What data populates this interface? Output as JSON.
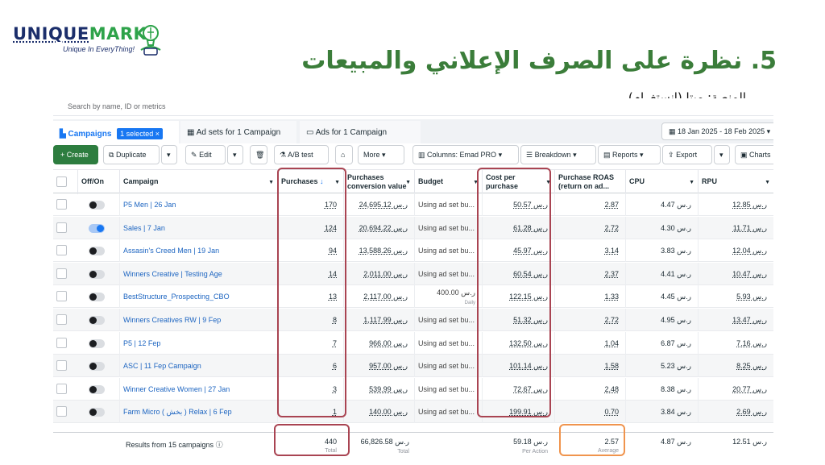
{
  "brand": {
    "name_a": "UNIQUE",
    "name_b": "MARK",
    "tagline": "Unique In EveryThing!"
  },
  "slide": {
    "title": "5. نظرة على الصرف الإعلاني والمبيعات",
    "subtitle": "المنصة: ميتا (انستغرام)"
  },
  "colors": {
    "title": "#3b7d3a",
    "accent": "#1877f2",
    "create": "#2d7d3f",
    "highlight_orange": "#f0944d",
    "highlight_red": "#a94452"
  },
  "search": {
    "placeholder": "Search by name, ID or metrics"
  },
  "tabs": {
    "campaigns": "Campaigns",
    "selected": "1 selected",
    "adsets": "Ad sets for 1 Campaign",
    "ads": "Ads for 1 Campaign",
    "date_range": "18 Jan 2025 - 18 Feb 2025"
  },
  "toolbar": {
    "create": "Create",
    "duplicate": "Duplicate",
    "edit": "Edit",
    "ab_test": "A/B test",
    "more": "More",
    "columns": "Columns: Emad PRO",
    "breakdown": "Breakdown",
    "reports": "Reports",
    "export": "Export",
    "charts": "Charts"
  },
  "columns": {
    "off_on": "Off/On",
    "campaign": "Campaign",
    "purchases": "Purchases",
    "conv_value_1": "Purchases",
    "conv_value_2": "conversion value",
    "budget": "Budget",
    "cpp_1": "Cost per",
    "cpp_2": "purchase",
    "roas_1": "Purchase ROAS",
    "roas_2": "(return on ad...",
    "cpu": "CPU",
    "rpu": "RPU"
  },
  "rows": [
    {
      "name": "P5 Men | 26 Jan",
      "purchases": "170",
      "value": "24,695.12 ر.س",
      "budget": "Using ad set bu...",
      "cpp": "50.57 ر.س",
      "roas": "2.87",
      "cpu": "4.47 ر.س",
      "rpu": "12.85 ر.س",
      "on": false
    },
    {
      "name": "Sales | 7 Jan",
      "purchases": "124",
      "value": "20,694.22 ر.س",
      "budget": "Using ad set bu...",
      "cpp": "61.28 ر.س",
      "roas": "2.72",
      "cpu": "4.30 ر.س",
      "rpu": "11.71 ر.س",
      "on": true
    },
    {
      "name": "Assasin's Creed Men | 19 Jan",
      "purchases": "94",
      "value": "13,588.26 ر.س",
      "budget": "Using ad set bu...",
      "cpp": "45.97 ر.س",
      "roas": "3.14",
      "cpu": "3.83 ر.س",
      "rpu": "12.04 ر.س",
      "on": false
    },
    {
      "name": "Winners Creative | Testing Age",
      "purchases": "14",
      "value": "2,011.00 ر.س",
      "budget": "Using ad set bu...",
      "cpp": "60.54 ر.س",
      "roas": "2.37",
      "cpu": "4.41 ر.س",
      "rpu": "10.47 ر.س",
      "on": false
    },
    {
      "name": "BestStructure_Prospecting_CBO",
      "purchases": "13",
      "value": "2,117.00 ر.س",
      "budget": "400.00 ر.س",
      "budget_sub": "Daily",
      "cpp": "122.15 ر.س",
      "roas": "1.33",
      "cpu": "4.45 ر.س",
      "rpu": "5.93 ر.س",
      "on": false
    },
    {
      "name": "Winners Creatives RW | 9 Fep",
      "purchases": "8",
      "value": "1,117.99 ر.س",
      "budget": "Using ad set bu...",
      "cpp": "51.32 ر.س",
      "roas": "2.72",
      "cpu": "4.95 ر.س",
      "rpu": "13.47 ر.س",
      "on": false
    },
    {
      "name": "P5 | 12 Fep",
      "purchases": "7",
      "value": "966.00 ر.س",
      "budget": "Using ad set bu...",
      "cpp": "132.50 ر.س",
      "roas": "1.04",
      "cpu": "6.87 ر.س",
      "rpu": "7.16 ر.س",
      "on": false
    },
    {
      "name": "ASC | 11 Fep Campaign",
      "purchases": "6",
      "value": "957.00 ر.س",
      "budget": "Using ad set bu...",
      "cpp": "101.14 ر.س",
      "roas": "1.58",
      "cpu": "5.23 ر.س",
      "rpu": "8.25 ر.س",
      "on": false
    },
    {
      "name": "Winner Creative Women | 27 Jan",
      "purchases": "3",
      "value": "539.99 ر.س",
      "budget": "Using ad set bu...",
      "cpp": "72.67 ر.س",
      "roas": "2.48",
      "cpu": "8.38 ر.س",
      "rpu": "20.77 ر.س",
      "on": false
    },
    {
      "name": "Farm Micro ( بخش ) Relax | 6 Fep",
      "purchases": "1",
      "value": "140.00 ر.س",
      "budget": "Using ad set bu...",
      "cpp": "199.91 ر.س",
      "roas": "0.70",
      "cpu": "3.84 ر.س",
      "rpu": "2.69 ر.س",
      "on": false
    }
  ],
  "totals": {
    "label": "Results from 15 campaigns",
    "purchases": "440",
    "purchases_label": "Total",
    "value": "66,826.58 ر.س",
    "value_label": "Total",
    "cpp": "59.18 ر.س",
    "cpp_label": "Per Action",
    "roas": "2.57",
    "roas_label": "Average",
    "cpu": "4.87 ر.س",
    "rpu": "12.51 ر.س"
  }
}
